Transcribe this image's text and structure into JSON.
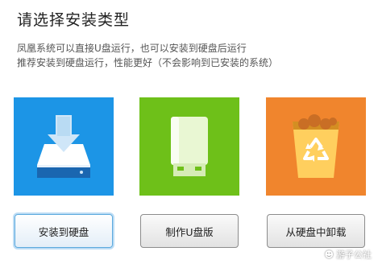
{
  "title": "请选择安装类型",
  "description": {
    "line1": "凤凰系统可以直接U盘运行，也可以安装到硬盘后运行",
    "line2": "推荐安装到硬盘运行，性能更好（不会影响到已安装的系统）"
  },
  "options": [
    {
      "id": "install",
      "label": "安装到硬盘",
      "icon": "hard-disk-download-icon",
      "color": "#1c95e6",
      "selected": true
    },
    {
      "id": "usb",
      "label": "制作U盘版",
      "icon": "usb-drive-icon",
      "color": "#6ec019",
      "selected": false
    },
    {
      "id": "remove",
      "label": "从硬盘中卸载",
      "icon": "recycle-bin-icon",
      "color": "#f0852d",
      "selected": false
    }
  ],
  "watermark": "游子公社"
}
